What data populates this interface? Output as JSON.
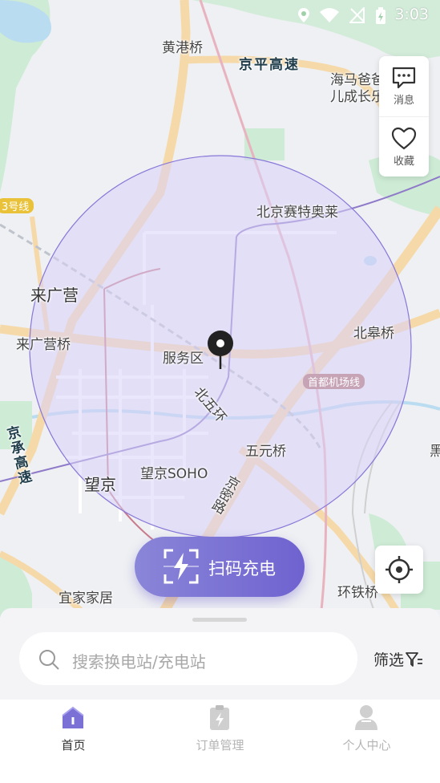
{
  "status_bar": {
    "time": "3:03"
  },
  "map_labels": {
    "huanggang_bridge": "黄港桥",
    "jingping_expressway": "京平高速",
    "haima_baba": "海马爸爸",
    "kids_growth": "儿成长乐",
    "metro_line_3": "3号线",
    "beijing_outlets": "北京赛特奥莱",
    "laiguangying": "来广营",
    "laiguangying_bridge": "来广营桥",
    "service_area": "服务区",
    "north_5th_ring": "北五环",
    "beigao_bridge": "北皋桥",
    "airport_line": "首都机场线",
    "jingcheng_expressway": "京承高速",
    "wuyuan_bridge": "五元桥",
    "wangjing_soho": "望京SOHO",
    "wangjing": "望京",
    "jingmi_road": "京密路",
    "yijiajiaju": "宜家家居",
    "ring_railway_bridge": "环铁桥",
    "hei": "黑"
  },
  "side_actions": {
    "messages": "消息",
    "favorites": "收藏"
  },
  "scan_button": {
    "label": "扫码充电"
  },
  "search": {
    "placeholder": "搜索换电站/充电站"
  },
  "filter": {
    "label": "筛选"
  },
  "tabs": [
    {
      "label": "首页",
      "active": true
    },
    {
      "label": "订单管理",
      "active": false
    },
    {
      "label": "个人中心",
      "active": false
    }
  ],
  "colors": {
    "accent": "#7a70d6",
    "range_fill": "#e7e3fb",
    "road": "#f6d9a8",
    "park": "#cdebd5",
    "water": "#b9dcf0"
  }
}
